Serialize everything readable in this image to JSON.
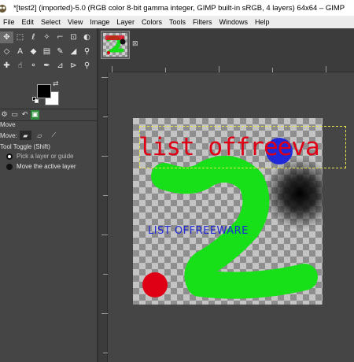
{
  "window": {
    "title": "*[test2] (imported)-5.0 (RGB color 8-bit gamma integer, GIMP built-in sRGB, 4 layers) 64x64 – GIMP"
  },
  "menubar": {
    "items": [
      "File",
      "Edit",
      "Select",
      "View",
      "Image",
      "Layer",
      "Colors",
      "Tools",
      "Filters",
      "Windows",
      "Help"
    ]
  },
  "toolbox": {
    "tools": [
      "move-tool",
      "rect-select-tool",
      "free-select-tool",
      "fuzzy-select-tool",
      "crop-tool",
      "unified-transform-tool",
      "warp-transform-tool",
      "cage-transform-tool",
      "text-tool",
      "bucket-fill-tool",
      "gradient-tool",
      "paintbrush-tool",
      "eraser-tool",
      "clone-tool",
      "heal-tool",
      "smudge-tool",
      "dodge-burn-tool",
      "paths-tool",
      "color-picker-tool",
      "measure-tool",
      "zoom-tool"
    ],
    "colors": {
      "foreground": "#000000",
      "background": "#ffffff"
    }
  },
  "tool_options": {
    "title": "Move",
    "move_label": "Move:",
    "toggle_label": "Tool Toggle  (Shift)",
    "option_pick": "Pick a layer or guide",
    "option_move_active": "Move the active layer"
  },
  "canvas": {
    "red_text": "list offreeva",
    "blue_text": "LIST OFFREEWARE",
    "colors": {
      "green": "#18e018",
      "red": "#e00016",
      "blue": "#2029d8"
    }
  }
}
